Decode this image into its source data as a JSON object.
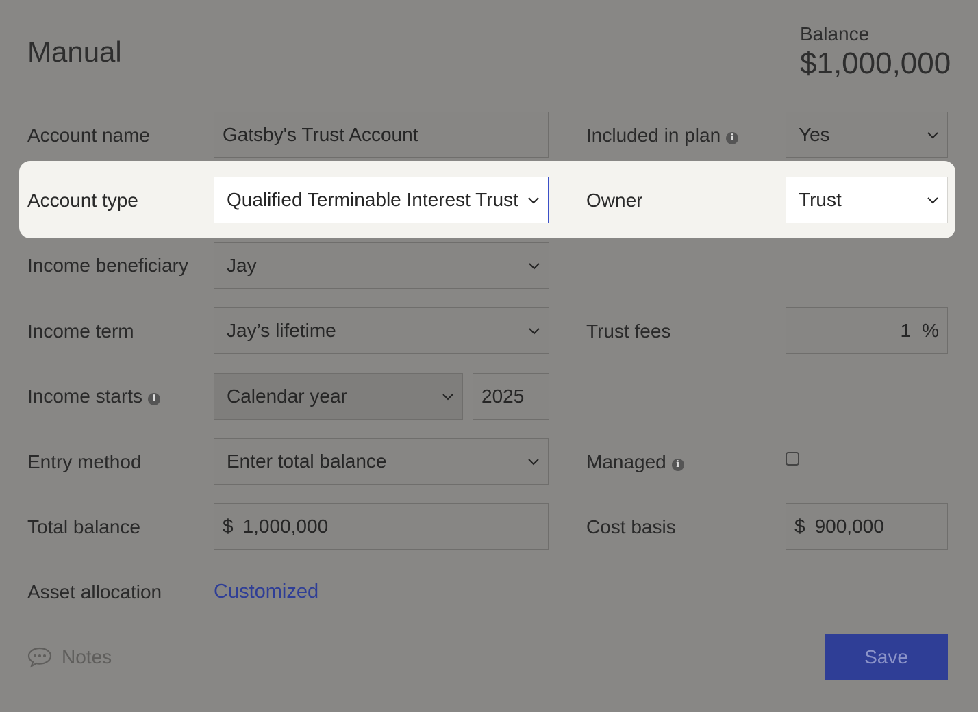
{
  "header": {
    "title": "Manual",
    "balance_label": "Balance",
    "balance_value": "$1,000,000"
  },
  "fields": {
    "account_name": {
      "label": "Account name",
      "value": "Gatsby's Trust Account"
    },
    "included_in_plan": {
      "label": "Included in plan",
      "value": "Yes"
    },
    "account_type": {
      "label": "Account type",
      "value": "Qualified Terminable Interest Trust"
    },
    "owner": {
      "label": "Owner",
      "value": "Trust"
    },
    "income_beneficiary": {
      "label": "Income beneficiary",
      "value": "Jay"
    },
    "income_term": {
      "label": "Income term",
      "value": "Jay’s lifetime"
    },
    "trust_fees": {
      "label": "Trust fees",
      "value": "1",
      "unit": "%"
    },
    "income_starts": {
      "label": "Income starts",
      "value": "Calendar year",
      "year": "2025"
    },
    "entry_method": {
      "label": "Entry method",
      "value": "Enter total balance"
    },
    "managed": {
      "label": "Managed",
      "checked": false
    },
    "total_balance": {
      "label": "Total balance",
      "currency": "$",
      "value": "1,000,000"
    },
    "cost_basis": {
      "label": "Cost basis",
      "currency": "$",
      "value": "900,000"
    },
    "asset_allocation": {
      "label": "Asset allocation",
      "link": "Customized"
    }
  },
  "footer": {
    "notes_label": "Notes",
    "save_label": "Save"
  },
  "colors": {
    "accent": "#2f3e96",
    "active_border": "#3b4fc7",
    "highlight_bg": "#f4f3ef"
  },
  "icons": [
    "info-icon",
    "chevron-down-icon",
    "speech-bubble-icon"
  ]
}
